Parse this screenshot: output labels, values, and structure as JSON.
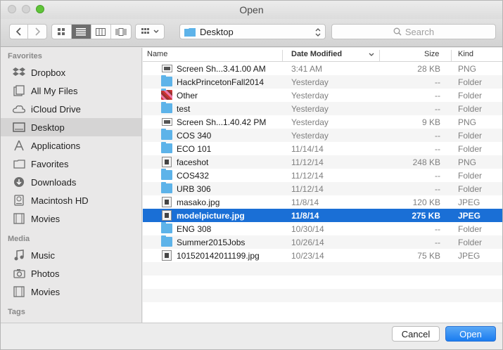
{
  "window": {
    "title": "Open"
  },
  "toolbar": {
    "location": "Desktop",
    "search_placeholder": "Search"
  },
  "sidebar": {
    "sections": [
      {
        "heading": "Favorites",
        "items": [
          {
            "label": "Dropbox",
            "icon": "dropbox-icon"
          },
          {
            "label": "All My Files",
            "icon": "all-files-icon"
          },
          {
            "label": "iCloud Drive",
            "icon": "cloud-icon"
          },
          {
            "label": "Desktop",
            "icon": "desktop-icon",
            "selected": true
          },
          {
            "label": "Applications",
            "icon": "applications-icon"
          },
          {
            "label": "Favorites",
            "icon": "folder-icon"
          },
          {
            "label": "Downloads",
            "icon": "downloads-icon"
          },
          {
            "label": "Macintosh HD",
            "icon": "hard-drive-icon"
          },
          {
            "label": "Movies",
            "icon": "film-icon"
          }
        ]
      },
      {
        "heading": "Media",
        "items": [
          {
            "label": "Music",
            "icon": "music-note-icon"
          },
          {
            "label": "Photos",
            "icon": "camera-icon"
          },
          {
            "label": "Movies",
            "icon": "film-icon"
          }
        ]
      },
      {
        "heading": "Tags",
        "items": []
      }
    ]
  },
  "columns": {
    "name": "Name",
    "date": "Date Modified",
    "size": "Size",
    "kind": "Kind"
  },
  "files": [
    {
      "name": "Screen Sh...3.41.00 AM",
      "date": "3:41 AM",
      "size": "28 KB",
      "kind": "PNG",
      "icon": "png-icon"
    },
    {
      "name": "HackPrincetonFall2014",
      "date": "Yesterday",
      "size": "--",
      "kind": "Folder",
      "icon": "folder-icon"
    },
    {
      "name": "Other",
      "date": "Yesterday",
      "size": "--",
      "kind": "Folder",
      "icon": "image-folder-icon"
    },
    {
      "name": "test",
      "date": "Yesterday",
      "size": "--",
      "kind": "Folder",
      "icon": "folder-icon"
    },
    {
      "name": "Screen Sh...1.40.42 PM",
      "date": "Yesterday",
      "size": "9 KB",
      "kind": "PNG",
      "icon": "png-icon"
    },
    {
      "name": "COS 340",
      "date": "Yesterday",
      "size": "--",
      "kind": "Folder",
      "icon": "folder-icon"
    },
    {
      "name": "ECO 101",
      "date": "11/14/14",
      "size": "--",
      "kind": "Folder",
      "icon": "folder-icon"
    },
    {
      "name": "faceshot",
      "date": "11/12/14",
      "size": "248 KB",
      "kind": "PNG",
      "icon": "image-icon"
    },
    {
      "name": "COS432",
      "date": "11/12/14",
      "size": "--",
      "kind": "Folder",
      "icon": "folder-icon"
    },
    {
      "name": "URB 306",
      "date": "11/12/14",
      "size": "--",
      "kind": "Folder",
      "icon": "folder-icon"
    },
    {
      "name": "masako.jpg",
      "date": "11/8/14",
      "size": "120 KB",
      "kind": "JPEG",
      "icon": "image-icon"
    },
    {
      "name": "modelpicture.jpg",
      "date": "11/8/14",
      "size": "275 KB",
      "kind": "JPEG",
      "icon": "image-icon",
      "selected": true
    },
    {
      "name": "ENG 308",
      "date": "10/30/14",
      "size": "--",
      "kind": "Folder",
      "icon": "folder-icon"
    },
    {
      "name": "Summer2015Jobs",
      "date": "10/26/14",
      "size": "--",
      "kind": "Folder",
      "icon": "folder-icon"
    },
    {
      "name": "101520142011199.jpg",
      "date": "10/23/14",
      "size": "75 KB",
      "kind": "JPEG",
      "icon": "image-icon"
    }
  ],
  "footer": {
    "cancel_label": "Cancel",
    "open_label": "Open"
  },
  "colors": {
    "accent": "#1a6fd6",
    "folder": "#5db3e9",
    "open_button": "#1a7cf0"
  }
}
